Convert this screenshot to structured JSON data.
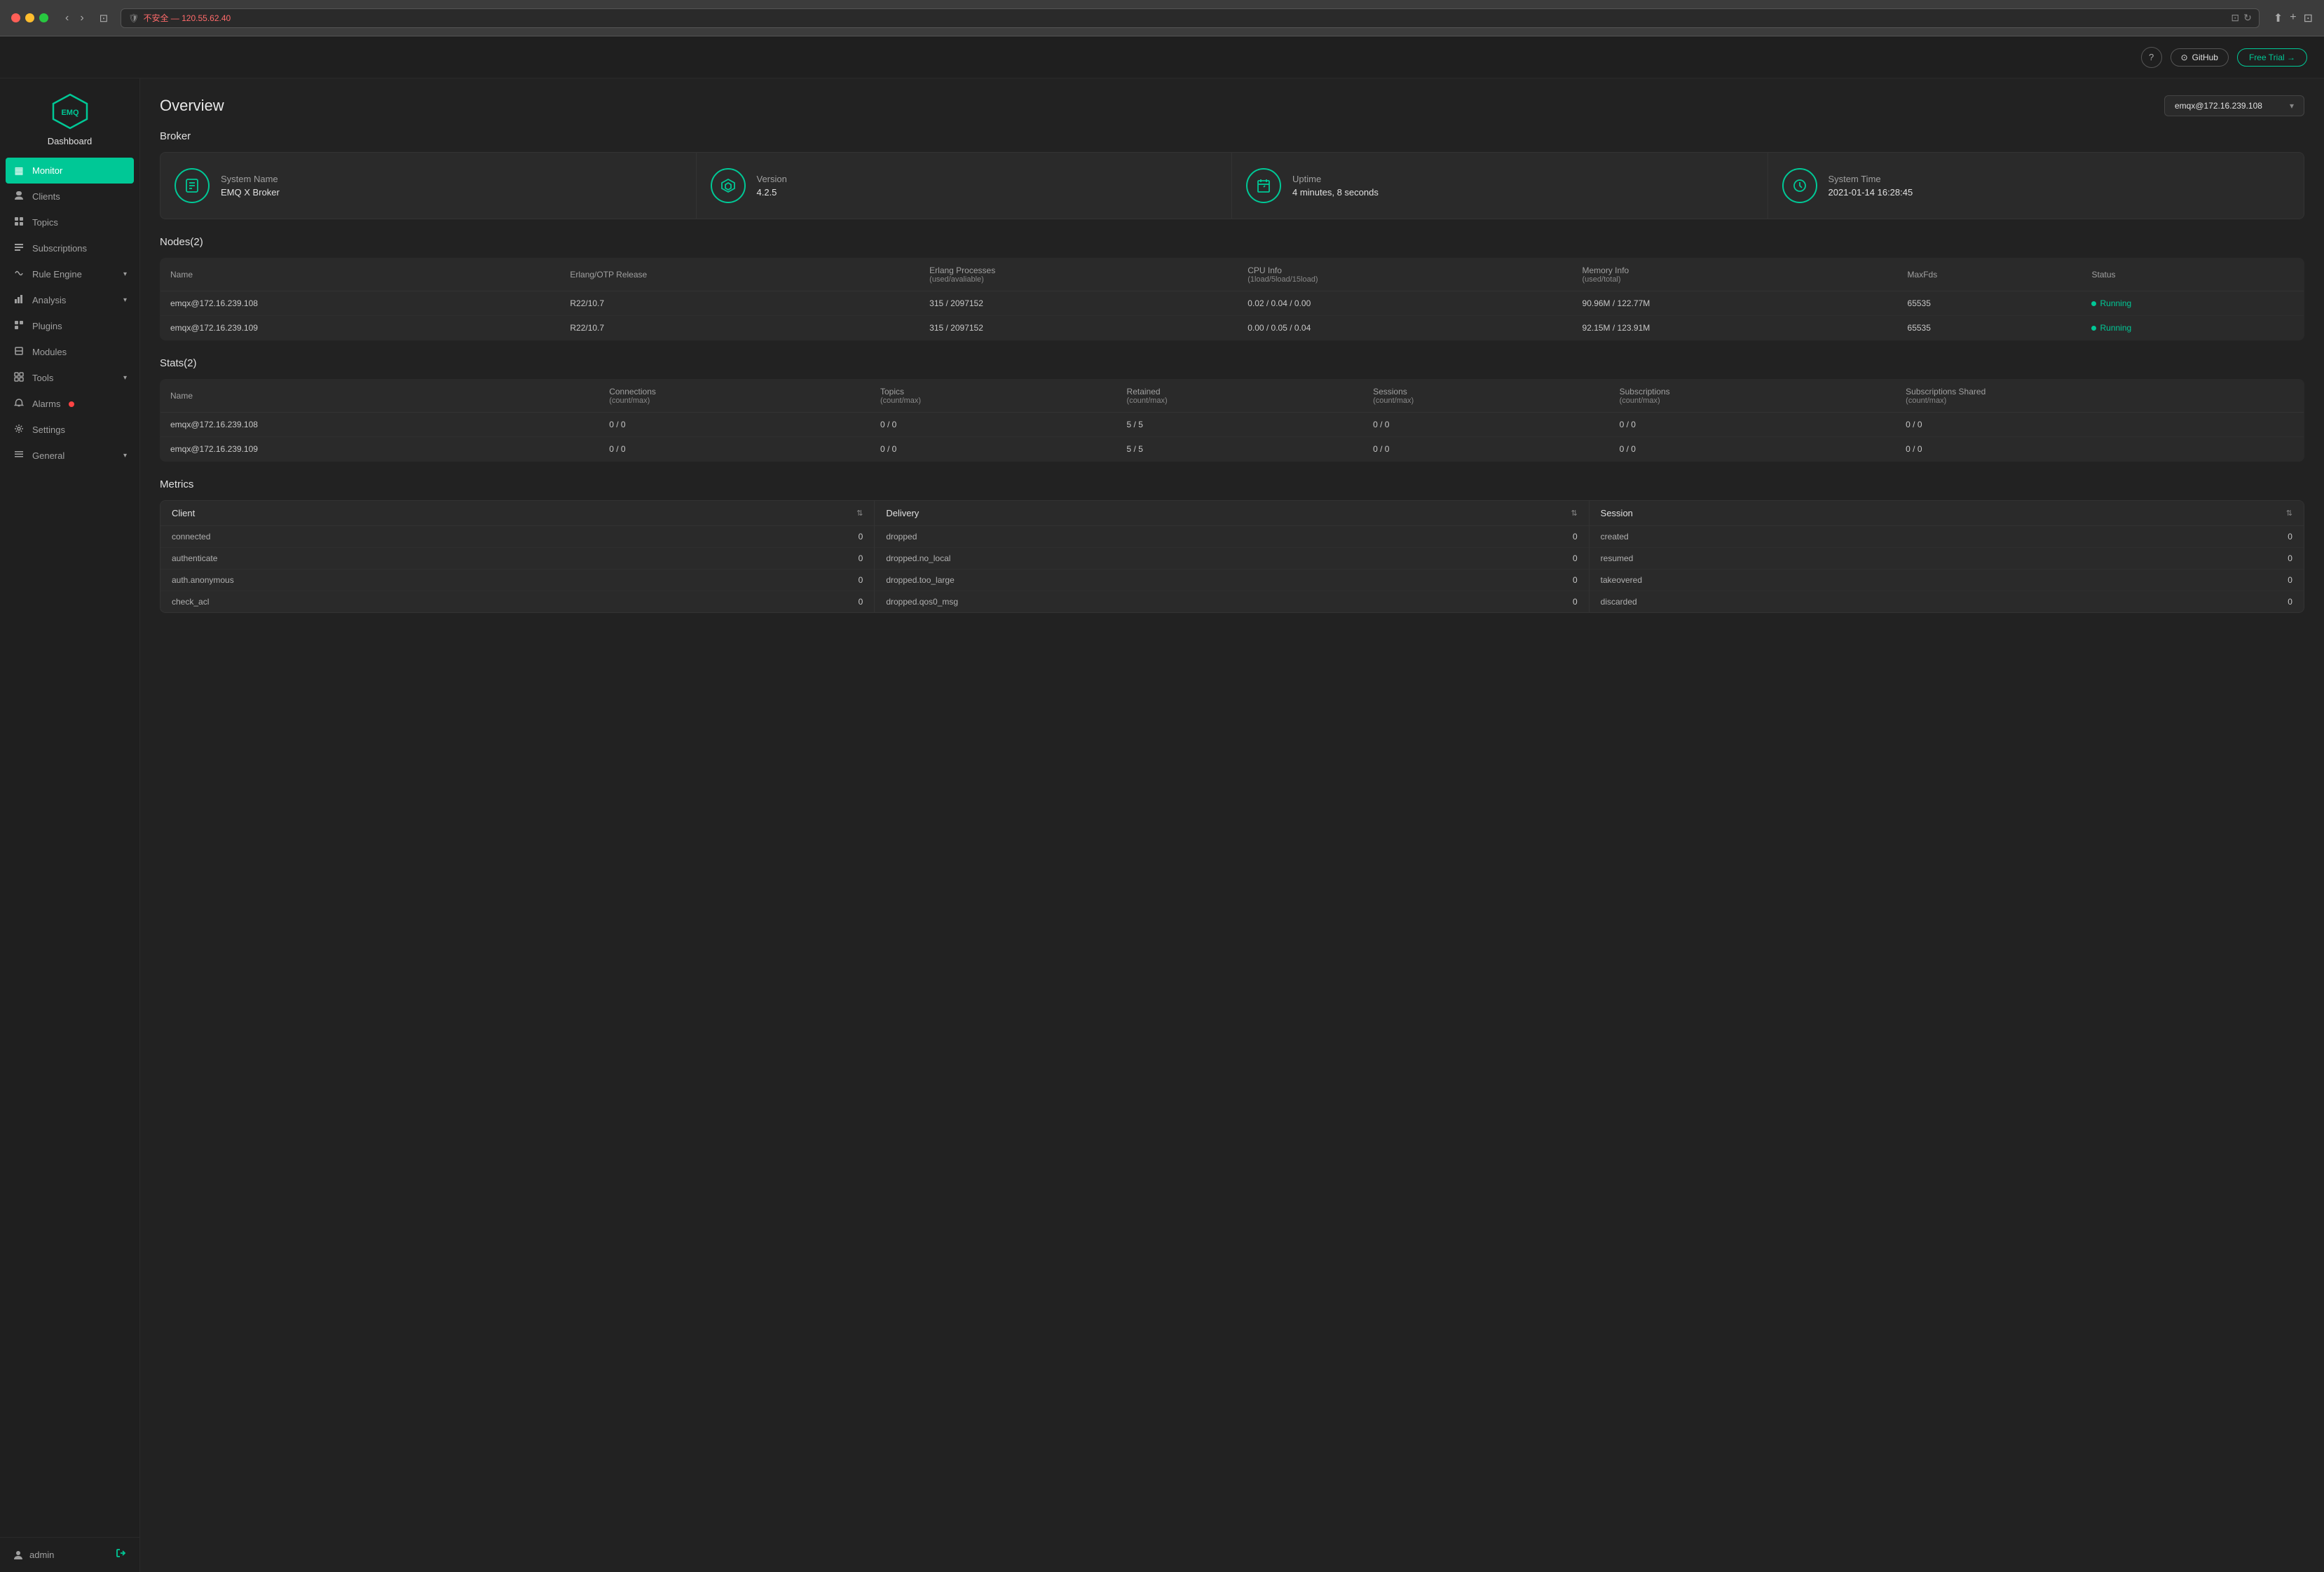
{
  "browser": {
    "address": "不安全 — 120.55.62.40",
    "address_secure_label": "不安全",
    "address_host": "120.55.62.40"
  },
  "header": {
    "help_label": "?",
    "github_label": "GitHub",
    "free_trial_label": "Free Trial →"
  },
  "sidebar": {
    "logo_text": "EMQ",
    "dashboard_label": "Dashboard",
    "items": [
      {
        "id": "monitor",
        "label": "Monitor",
        "icon": "▦",
        "active": true,
        "has_arrow": false,
        "has_badge": false
      },
      {
        "id": "clients",
        "label": "Clients",
        "icon": "👤",
        "active": false,
        "has_arrow": false,
        "has_badge": false
      },
      {
        "id": "topics",
        "label": "Topics",
        "icon": "⊞",
        "active": false,
        "has_arrow": false,
        "has_badge": false
      },
      {
        "id": "subscriptions",
        "label": "Subscriptions",
        "icon": "☰",
        "active": false,
        "has_arrow": false,
        "has_badge": false
      },
      {
        "id": "rule-engine",
        "label": "Rule Engine",
        "icon": "⟲",
        "active": false,
        "has_arrow": true,
        "has_badge": false
      },
      {
        "id": "analysis",
        "label": "Analysis",
        "icon": "⬚",
        "active": false,
        "has_arrow": true,
        "has_badge": false
      },
      {
        "id": "plugins",
        "label": "Plugins",
        "icon": "☑",
        "active": false,
        "has_arrow": false,
        "has_badge": false
      },
      {
        "id": "modules",
        "label": "Modules",
        "icon": "⊡",
        "active": false,
        "has_arrow": false,
        "has_badge": false
      },
      {
        "id": "tools",
        "label": "Tools",
        "icon": "⊞",
        "active": false,
        "has_arrow": true,
        "has_badge": false
      },
      {
        "id": "alarms",
        "label": "Alarms",
        "icon": "⏰",
        "active": false,
        "has_arrow": false,
        "has_badge": true
      },
      {
        "id": "settings",
        "label": "Settings",
        "icon": "⚙",
        "active": false,
        "has_arrow": false,
        "has_badge": false
      },
      {
        "id": "general",
        "label": "General",
        "icon": "▤",
        "active": false,
        "has_arrow": true,
        "has_badge": false
      }
    ],
    "user_label": "admin",
    "logout_icon": "⊣"
  },
  "overview": {
    "title": "Overview",
    "node_selector": "emqx@172.16.239.108",
    "broker_section_title": "Broker",
    "broker_cards": [
      {
        "icon": "📄",
        "label": "System Name",
        "value": "EMQ X Broker"
      },
      {
        "icon": "⬡",
        "label": "Version",
        "value": "4.2.5"
      },
      {
        "icon": "⏳",
        "label": "Uptime",
        "value": "4 minutes, 8 seconds"
      },
      {
        "icon": "🕐",
        "label": "System Time",
        "value": "2021-01-14 16:28:45"
      }
    ],
    "nodes_section_title": "Nodes(2)",
    "nodes_table": {
      "headers": [
        {
          "id": "name",
          "label": "Name"
        },
        {
          "id": "erlang_otp",
          "label": "Erlang/OTP Release"
        },
        {
          "id": "erlang_processes",
          "label": "Erlang Processes",
          "sub": "(used/avaliable)"
        },
        {
          "id": "cpu_info",
          "label": "CPU Info",
          "sub": "(1load/5load/15load)"
        },
        {
          "id": "memory_info",
          "label": "Memory Info",
          "sub": "(used/total)"
        },
        {
          "id": "maxfds",
          "label": "MaxFds"
        },
        {
          "id": "status",
          "label": "Status"
        }
      ],
      "rows": [
        {
          "name": "emqx@172.16.239.108",
          "erlang_otp": "R22/10.7",
          "erlang_processes": "315 / 2097152",
          "cpu_info": "0.02 / 0.04 / 0.00",
          "memory_info": "90.96M / 122.77M",
          "maxfds": "65535",
          "status": "Running"
        },
        {
          "name": "emqx@172.16.239.109",
          "erlang_otp": "R22/10.7",
          "erlang_processes": "315 / 2097152",
          "cpu_info": "0.00 / 0.05 / 0.04",
          "memory_info": "92.15M / 123.91M",
          "maxfds": "65535",
          "status": "Running"
        }
      ]
    },
    "stats_section_title": "Stats(2)",
    "stats_table": {
      "headers": [
        {
          "id": "name",
          "label": "Name"
        },
        {
          "id": "connections",
          "label": "Connections",
          "sub": "(count/max)"
        },
        {
          "id": "topics",
          "label": "Topics",
          "sub": "(count/max)"
        },
        {
          "id": "retained",
          "label": "Retained",
          "sub": "(count/max)"
        },
        {
          "id": "sessions",
          "label": "Sessions",
          "sub": "(count/max)"
        },
        {
          "id": "subscriptions",
          "label": "Subscriptions",
          "sub": "(count/max)"
        },
        {
          "id": "subscriptions_shared",
          "label": "Subscriptions Shared",
          "sub": "(count/max)"
        }
      ],
      "rows": [
        {
          "name": "emqx@172.16.239.108",
          "connections": "0 / 0",
          "topics": "0 / 0",
          "retained": "5 / 5",
          "sessions": "0 / 0",
          "subscriptions": "0 / 0",
          "subscriptions_shared": "0 / 0"
        },
        {
          "name": "emqx@172.16.239.109",
          "connections": "0 / 0",
          "topics": "0 / 0",
          "retained": "5 / 5",
          "sessions": "0 / 0",
          "subscriptions": "0 / 0",
          "subscriptions_shared": "0 / 0"
        }
      ]
    },
    "metrics_section_title": "Metrics",
    "metrics": {
      "client": {
        "header": "Client",
        "rows": [
          {
            "name": "connected",
            "value": "0"
          },
          {
            "name": "authenticate",
            "value": "0"
          },
          {
            "name": "auth.anonymous",
            "value": "0"
          },
          {
            "name": "check_acl",
            "value": "0"
          }
        ]
      },
      "delivery": {
        "header": "Delivery",
        "rows": [
          {
            "name": "dropped",
            "value": "0"
          },
          {
            "name": "dropped.no_local",
            "value": "0"
          },
          {
            "name": "dropped.too_large",
            "value": "0"
          },
          {
            "name": "dropped.qos0_msg",
            "value": "0"
          }
        ]
      },
      "session": {
        "header": "Session",
        "rows": [
          {
            "name": "created",
            "value": "0"
          },
          {
            "name": "resumed",
            "value": "0"
          },
          {
            "name": "takeovered",
            "value": "0"
          },
          {
            "name": "discarded",
            "value": "0"
          }
        ]
      }
    }
  }
}
